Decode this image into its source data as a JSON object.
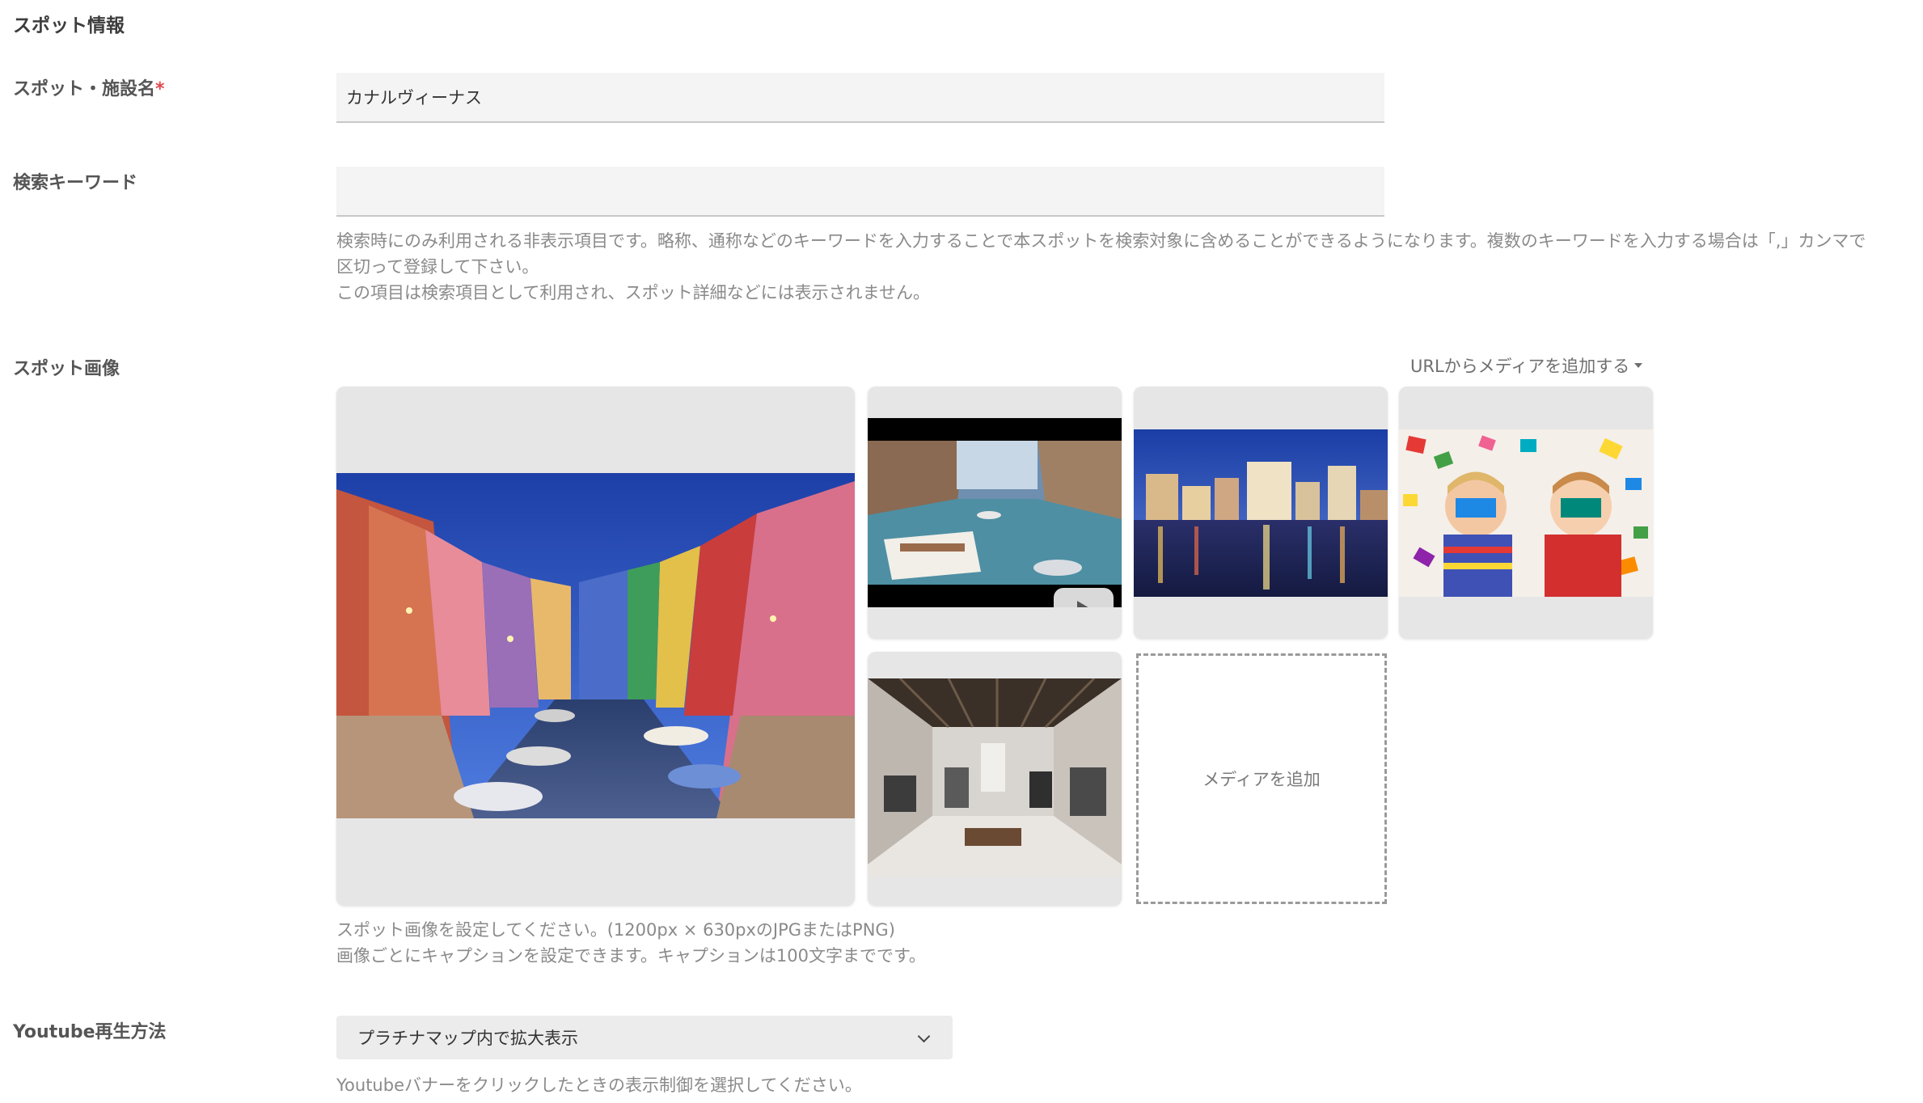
{
  "section": {
    "title": "スポット情報"
  },
  "spot_name": {
    "label": "スポット・施設名",
    "required_mark": "*",
    "value": "カナルヴィーナス"
  },
  "keywords": {
    "label": "検索キーワード",
    "value": "",
    "help_line1": "検索時にのみ利用される非表示項目です。略称、通称などのキーワードを入力することで本スポットを検索対象に含めることができるようになります。複数のキーワードを入力する場合は「,」カンマで",
    "help_line2": "区切って登録して下さい。",
    "help_line3": "この項目は検索項目として利用され、スポット詳細などには表示されません。"
  },
  "spot_images": {
    "label": "スポット画像",
    "url_menu_label": "URLからメディアを追加する",
    "add_media_label": "メディアを追加",
    "media": [
      {
        "name": "canal-colorful-houses",
        "type": "image"
      },
      {
        "name": "canal-boats-video",
        "type": "youtube"
      },
      {
        "name": "night-waterfront-city",
        "type": "image"
      },
      {
        "name": "kids-with-toy-blocks",
        "type": "image"
      },
      {
        "name": "clothing-store-interior",
        "type": "image"
      }
    ],
    "help_line1": "スポット画像を設定してください。(1200px × 630pxのJPGまたはPNG)",
    "help_line2": "画像ごとにキャプションを設定できます。キャプションは100文字までです。"
  },
  "youtube": {
    "label": "Youtube再生方法",
    "selected": "プラチナマップ内で拡大表示",
    "help": "Youtubeバナーをクリックしたときの表示制御を選択してください。"
  },
  "colors": {
    "required": "#e0474c",
    "input_bg": "#f4f4f4",
    "card_bg": "#e6e6e6",
    "help_text": "#8a8a8a"
  }
}
